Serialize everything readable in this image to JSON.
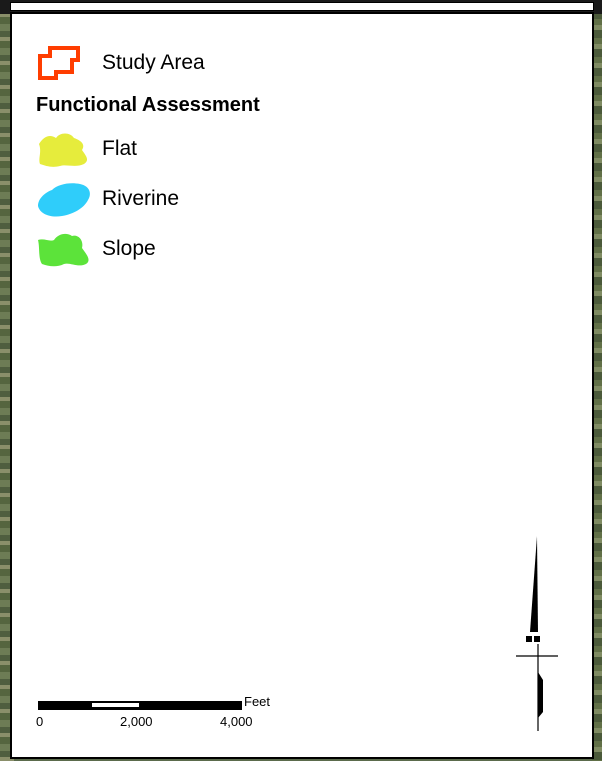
{
  "legend": {
    "study_area": {
      "label": "Study Area",
      "color": "#ff3d00",
      "icon": "study-area-outline-icon"
    },
    "heading": "Functional Assessment",
    "classes": [
      {
        "label": "Flat",
        "color": "#e6ec3c",
        "icon": "flat-polygon-icon"
      },
      {
        "label": "Riverine",
        "color": "#2fcdfa",
        "icon": "riverine-polygon-icon"
      },
      {
        "label": "Slope",
        "color": "#5ce33a",
        "icon": "slope-polygon-icon"
      }
    ]
  },
  "scale_bar": {
    "unit": "Feet",
    "ticks": [
      "0",
      "2,000",
      "4,000"
    ]
  },
  "north_arrow": {
    "icon": "north-arrow-icon"
  }
}
